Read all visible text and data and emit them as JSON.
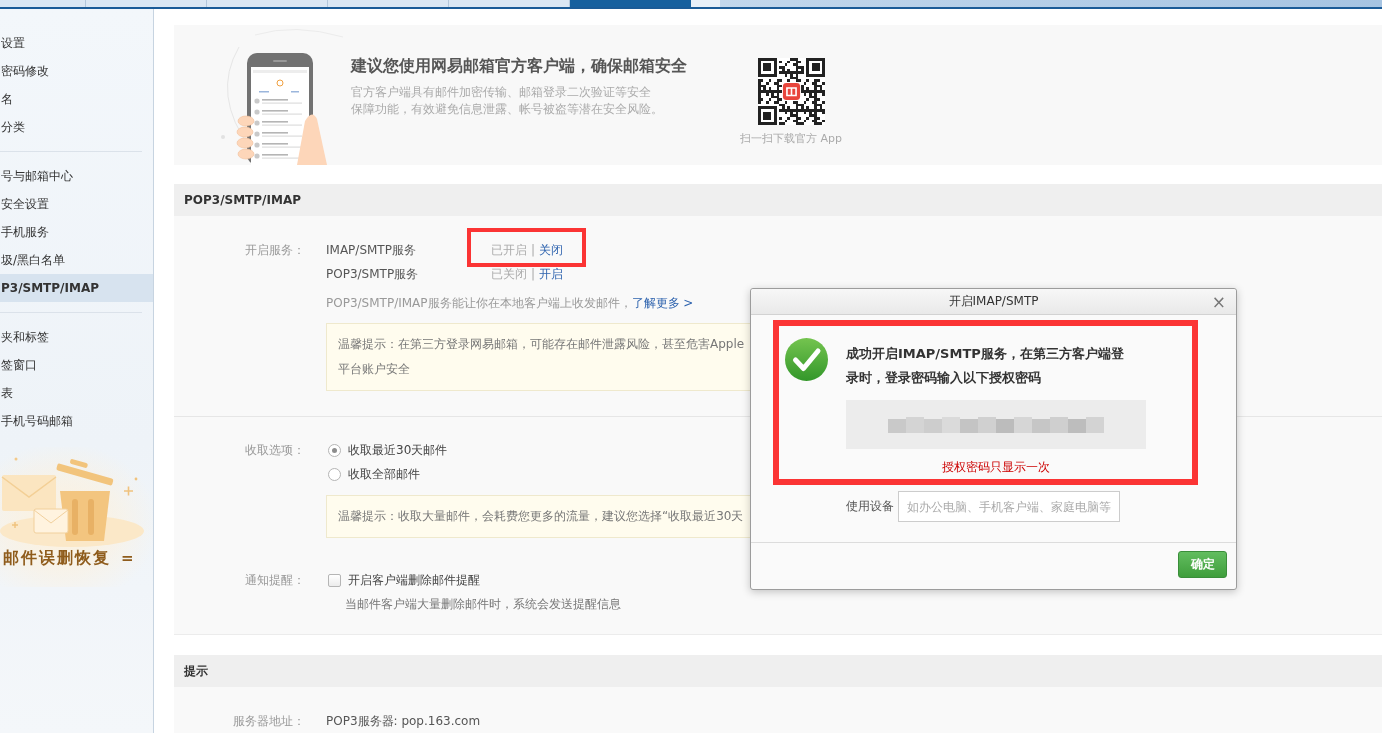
{
  "top_tabs": [
    {
      "selected": false
    },
    {
      "selected": false
    },
    {
      "selected": false
    },
    {
      "selected": false
    },
    {
      "selected": false
    },
    {
      "selected": true
    }
  ],
  "sidebar": {
    "groups": [
      {
        "items": [
          {
            "label": "设置",
            "selected": false
          },
          {
            "label": "密码修改",
            "selected": false
          },
          {
            "label": "名",
            "selected": false
          },
          {
            "label": "分类",
            "selected": false
          }
        ]
      },
      {
        "items": [
          {
            "label": "号与邮箱中心",
            "selected": false
          },
          {
            "label": "安全设置",
            "selected": false
          },
          {
            "label": "手机服务",
            "selected": false
          },
          {
            "label": "圾/黑白名单",
            "selected": false
          },
          {
            "label": "P3/SMTP/IMAP",
            "selected": true
          }
        ]
      },
      {
        "items": [
          {
            "label": "夹和标签",
            "selected": false
          },
          {
            "label": "签窗口",
            "selected": false
          },
          {
            "label": "表",
            "selected": false
          },
          {
            "label": "手机号码邮箱",
            "selected": false
          }
        ]
      }
    ],
    "promo": {
      "title": "邮件误删恢复",
      "mark": "="
    }
  },
  "banner": {
    "title": "建议您使用网易邮箱官方客户端，确保邮箱安全",
    "description_lines": [
      "官方客户端具有邮件加密传输、邮箱登录二次验证等安全",
      "保障功能，有效避免信息泄露、帐号被盗等潜在安全风险。"
    ],
    "qr_caption": "扫一扫下载官方 App"
  },
  "pop_section": {
    "title": "POP3/SMTP/IMAP",
    "service_label": "开启服务：",
    "services": [
      {
        "name": "IMAP/SMTP服务",
        "status": "已开启",
        "separator": "|",
        "action": "关闭",
        "highlighted": true
      },
      {
        "name": "POP3/SMTP服务",
        "status": "已关闭",
        "separator": "|",
        "action": "开启",
        "highlighted": false
      }
    ],
    "description": "POP3/SMTP/IMAP服务能让你在本地客户端上收发邮件，",
    "learn_more": "了解更多 >",
    "notice_lines": [
      "温馨提示：在第三方登录网易邮箱，可能存在邮件泄露风险，甚至危害Apple",
      "平台账户安全"
    ],
    "receive_label": "收取选项：",
    "receive_options": [
      {
        "label": "收取最近30天邮件",
        "selected": true
      },
      {
        "label": "收取全部邮件",
        "selected": false
      }
    ],
    "receive_notice": "温馨提示：收取大量邮件，会耗费您更多的流量，建议您选择“收取最近30天",
    "notify_label": "通知提醒：",
    "notify_option": {
      "label": "开启客户端删除邮件提醒",
      "checked": false
    },
    "notify_hint": "当邮件客户端大量删除邮件时，系统会发送提醒信息"
  },
  "tips_section": {
    "title": "提示",
    "rows": [
      {
        "label": "服务器地址：",
        "value": "POP3服务器: pop.163.com"
      }
    ]
  },
  "dialog": {
    "title": "开启IMAP/SMTP",
    "close": "×",
    "message": "成功开启IMAP/SMTP服务，在第三方客户端登录时，登录密码输入以下授权密码",
    "highlighted": true,
    "warning": "授权密码只显示一次",
    "device_label": "使用设备",
    "device_placeholder": "如办公电脑、手机客户端、家庭电脑等",
    "confirm": "确定"
  }
}
